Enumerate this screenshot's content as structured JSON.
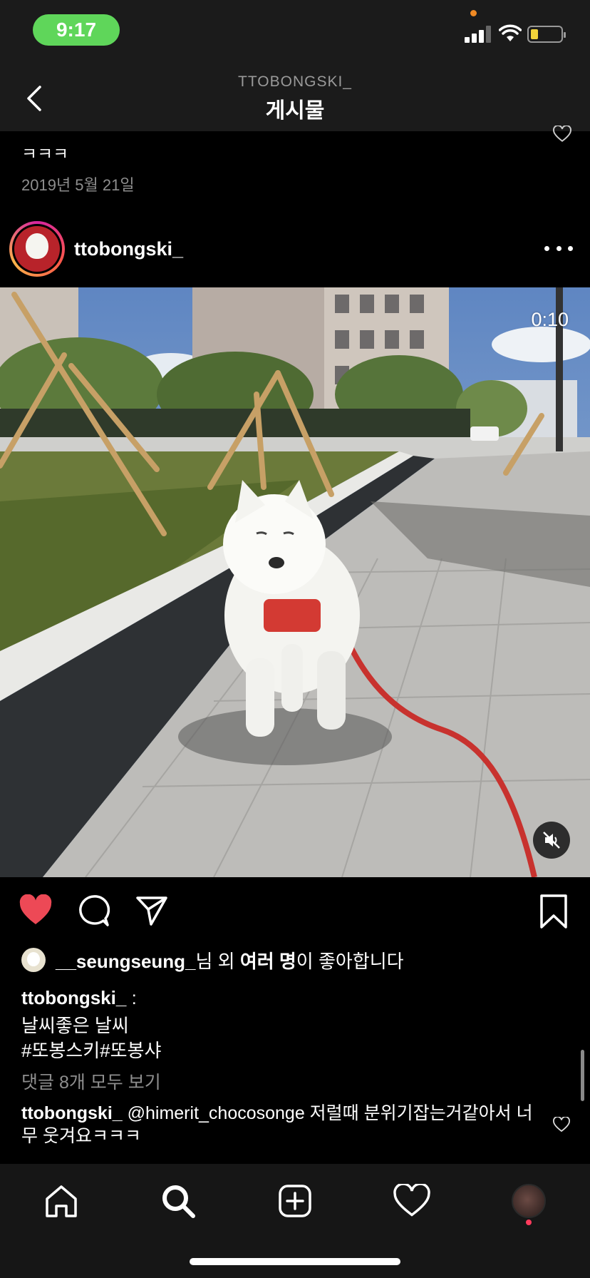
{
  "status_bar": {
    "time": "9:17"
  },
  "header": {
    "username": "TTOBONGSKI_",
    "title": "게시물"
  },
  "previous_post": {
    "caption_fragment": "ㅋㅋㅋ",
    "date": "2019년 5월 21일"
  },
  "post": {
    "username": "ttobongski_",
    "video": {
      "remaining_time": "0:10",
      "muted": true
    },
    "liked": true,
    "likes": {
      "liker": "__seungseung_",
      "suffix_1": "님 외 ",
      "others": "여러 명",
      "suffix_2": "이 좋아합니다"
    },
    "caption": {
      "username": "ttobongski_",
      "colon": " :",
      "line1": "날씨좋은 날씨",
      "line2": "#또봉스키#또봉샤"
    },
    "view_comments": "댓글 8개 모두 보기",
    "comments": [
      {
        "username": "ttobongski_",
        "text": " @himerit_chocosonge 저럴때 분위기잡는거같아서 너무 웃겨요ㅋㅋㅋ"
      }
    ]
  },
  "colors": {
    "like_red": "#ed4956",
    "status_green": "#5fd65a",
    "background": "#000000",
    "muted_text": "#8e8e8e"
  },
  "icons": {
    "back": "chevron-left-icon",
    "more": "more-horizontal-icon",
    "like": "heart-filled-icon",
    "comment": "comment-bubble-icon",
    "share": "paper-plane-icon",
    "save": "bookmark-icon",
    "mute": "speaker-muted-icon",
    "nav": [
      "home-icon",
      "search-icon",
      "add-post-icon",
      "activity-heart-icon",
      "profile-avatar"
    ]
  }
}
